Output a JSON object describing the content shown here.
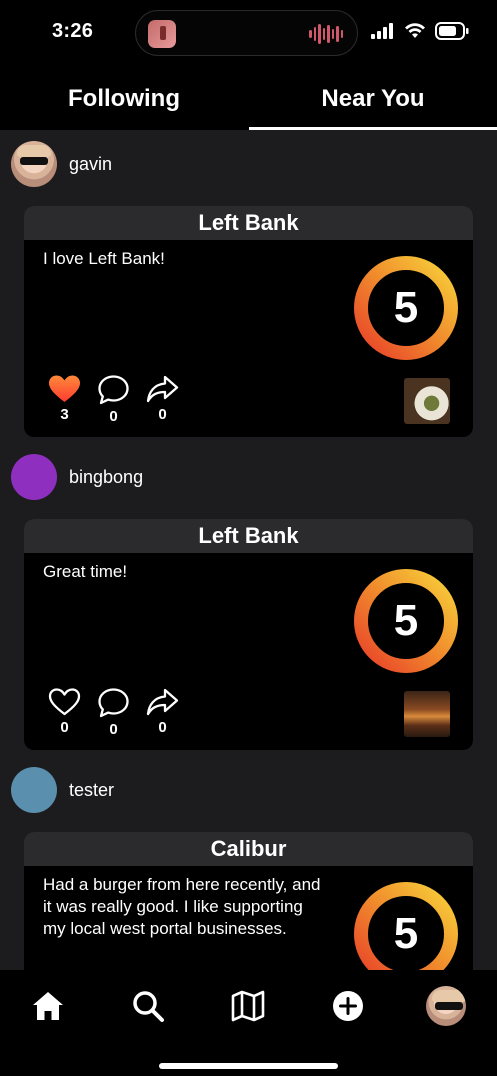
{
  "status_bar": {
    "time": "3:26"
  },
  "tabs": [
    {
      "label": "Following",
      "active": false
    },
    {
      "label": "Near You",
      "active": true
    }
  ],
  "posts": [
    {
      "username": "gavin",
      "avatar": "photo",
      "place": "Left Bank",
      "text": "I love Left Bank!",
      "rating": "5",
      "liked": true,
      "likes": "3",
      "comments": "0",
      "shares": "0",
      "thumbnail": "food-photo"
    },
    {
      "username": "bingbong",
      "avatar_color": "#8f2fbf",
      "place": "Left Bank",
      "text": "Great time!",
      "rating": "5",
      "liked": false,
      "likes": "0",
      "comments": "0",
      "shares": "0",
      "thumbnail": "restaurant-photo"
    },
    {
      "username": "tester",
      "avatar_color": "#5a8fad",
      "place": "Calibur",
      "text": "Had a burger from here recently, and it was really good. I like supporting my local west portal businesses.",
      "rating": "5"
    }
  ],
  "nav": {
    "items": [
      "home-icon",
      "search-icon",
      "map-icon",
      "add-icon",
      "profile-avatar"
    ]
  },
  "colors": {
    "ring_start": "#e8402a",
    "ring_end": "#f7d23a",
    "like_red": "#ff3b30"
  }
}
